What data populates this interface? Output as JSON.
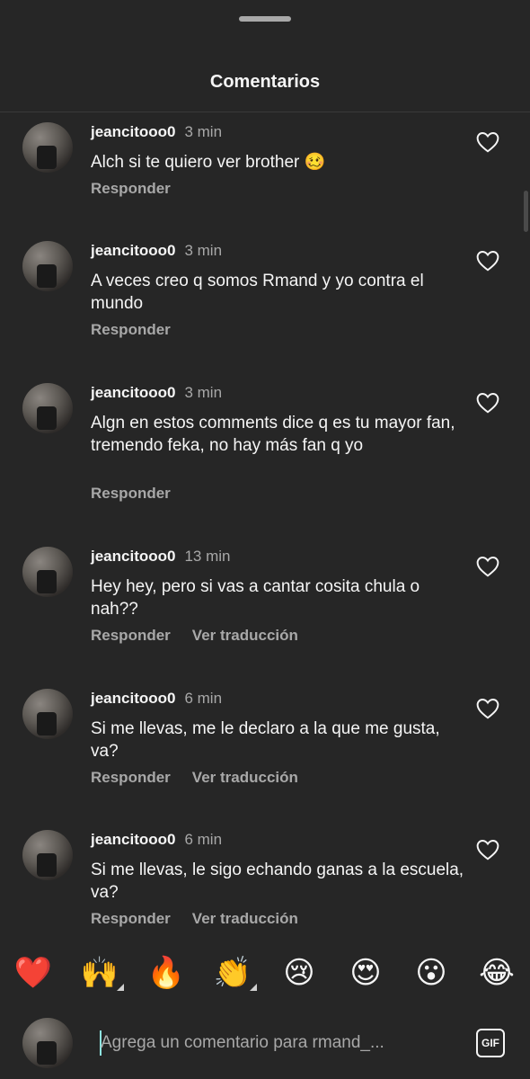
{
  "header": {
    "title": "Comentarios"
  },
  "comments": [
    {
      "user": "jeancitooo0",
      "time": "3 min",
      "text": "Alch si te quiero ver brother 🥴",
      "reply": "Responder",
      "translate": ""
    },
    {
      "user": "jeancitooo0",
      "time": "3 min",
      "text": "A veces creo q somos Rmand y yo contra el mundo",
      "reply": "Responder",
      "translate": ""
    },
    {
      "user": "jeancitooo0",
      "time": "3 min",
      "text": "Algn en estos comments dice q es tu mayor fan, tremendo feka, no hay más fan q yo",
      "reply": "Responder",
      "translate": ""
    },
    {
      "user": "jeancitooo0",
      "time": "13 min",
      "text": "Hey hey, pero si vas a cantar cosita chula o nah??",
      "reply": "Responder",
      "translate": "Ver traducción"
    },
    {
      "user": "jeancitooo0",
      "time": "6 min",
      "text": "Si me llevas, me le declaro a la que me gusta, va?",
      "reply": "Responder",
      "translate": "Ver traducción"
    },
    {
      "user": "jeancitooo0",
      "time": "6 min",
      "text": "Si me llevas, le sigo echando ganas a la escuela, va?",
      "reply": "Responder",
      "translate": "Ver traducción"
    }
  ],
  "emoji_bar": [
    "❤️",
    "🙌",
    "🔥",
    "👏",
    "😢",
    "😍",
    "😮",
    "😂"
  ],
  "composer": {
    "placeholder": "Agrega un comentario para rmand_...",
    "gif_label": "GIF"
  },
  "colors": {
    "background": "#262626",
    "text": "#f5f5f5",
    "muted": "#a8a8a8",
    "cursor": "#8ee4e0"
  }
}
